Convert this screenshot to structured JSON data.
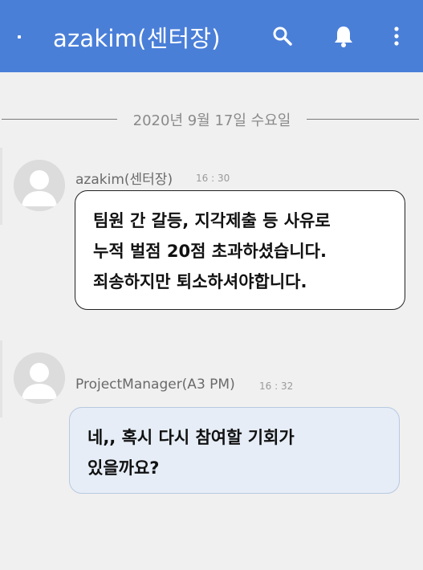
{
  "header": {
    "title": "azakim(센터장)",
    "icons": [
      "search-icon",
      "bell-icon",
      "more-vert-icon"
    ],
    "background_color": "#4a7fd8"
  },
  "date_separator": {
    "text": "2020년 9월 17일 수요일"
  },
  "messages": [
    {
      "sender": "azakim(센터장)",
      "time": "16 : 30",
      "lines": [
        "팀원 간 갈등, 지각제출 등 사유로",
        "누적 벌점 20점 초과하셨습니다.",
        "죄송하지만 퇴소하셔야합니다."
      ],
      "bubble_color": "#ffffff"
    },
    {
      "sender": "ProjectManager(A3 PM)",
      "time": "16 : 32",
      "lines": [
        "네,, 혹시 다시 참여할 기회가",
        "있을까요?"
      ],
      "bubble_color": "#e6edf7"
    }
  ]
}
